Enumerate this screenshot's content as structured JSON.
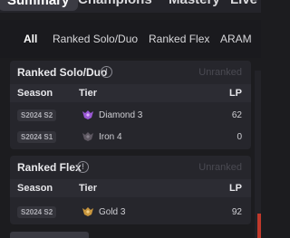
{
  "top_tabs": {
    "summary": "Summary",
    "champions": "Champions",
    "mastery": "Mastery",
    "live": "Live Ga"
  },
  "filters": [
    "All",
    "Ranked Solo/Duo",
    "Ranked Flex",
    "ARAM"
  ],
  "solo_card": {
    "title": "Ranked Solo/Duo",
    "status": "Unranked",
    "columns": {
      "season": "Season",
      "tier": "Tier",
      "lp": "LP"
    },
    "rows": [
      {
        "season": "S2024 S2",
        "tier": "Diamond 3",
        "lp": "62",
        "icon": "diamond-emblem-icon",
        "color": "#9b59d6"
      },
      {
        "season": "S2024 S1",
        "tier": "Iron 4",
        "lp": "0",
        "icon": "iron-emblem-icon",
        "color": "#6d6670"
      }
    ]
  },
  "flex_card": {
    "title": "Ranked Flex",
    "status": "Unranked",
    "columns": {
      "season": "Season",
      "tier": "Tier",
      "lp": "LP"
    },
    "rows": [
      {
        "season": "S2024 S2",
        "tier": "Gold 3",
        "lp": "92",
        "icon": "gold-emblem-icon",
        "color": "#c8963e"
      }
    ]
  },
  "info_glyph": "!",
  "colors": {
    "background": "#1c1c1f",
    "card": "#26262c",
    "accent_red": "#c0392b"
  }
}
